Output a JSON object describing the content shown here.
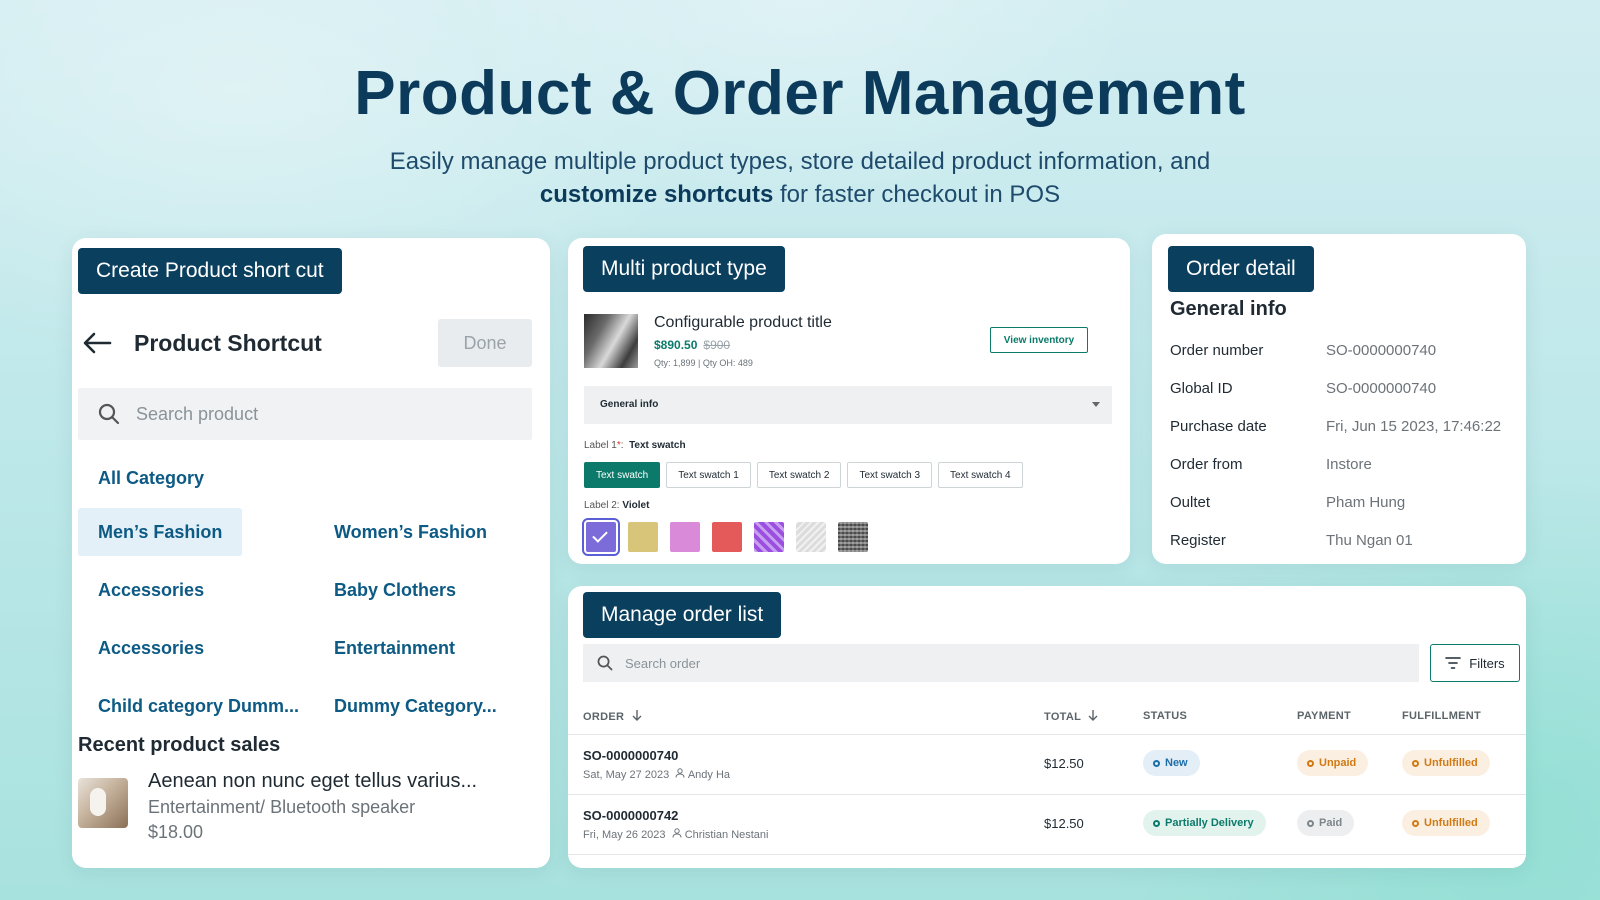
{
  "hero": {
    "title": "Product & Order Management",
    "subtitle_line1": "Easily manage multiple product types, store detailed product information, and",
    "subtitle_bold": "customize shortcuts",
    "subtitle_rest": " for faster checkout in POS"
  },
  "shortcut_card": {
    "tag": "Create Product short cut",
    "title": "Product Shortcut",
    "done_label": "Done",
    "search_placeholder": "Search product",
    "categories": [
      "All Category",
      "Men’s Fashion",
      "Women’s Fashion",
      "Accessories",
      "Baby Clothers",
      "Accessories",
      "Entertainment",
      "Child category Dumm...",
      "Dummy Category..."
    ],
    "recent_title": "Recent product sales",
    "recent_item": {
      "name": "Aenean non nunc eget tellus varius...",
      "category": "Entertainment/ Bluetooth speaker",
      "price": "$18.00"
    }
  },
  "product_card": {
    "tag": "Multi product type",
    "title": "Configurable product title",
    "price": "$890.50",
    "old_price": "$900",
    "qty": "Qty: 1,899 | Qty OH: 489",
    "view_inventory": "View inventory",
    "general_info": "General info",
    "label1_name": "Label 1",
    "label1_req": "*",
    "label1_value": "Text swatch",
    "swatches": [
      "Text swatch",
      "Text swatch 1",
      "Text swatch 2",
      "Text swatch 3",
      "Text swatch 4"
    ],
    "label2_name": "Label 2:",
    "label2_value": "Violet",
    "colors": [
      "#7b6cd9",
      "#d8c57a",
      "#d98ad8",
      "#e45a5a",
      "#9a4fe0",
      "#dcdcdc",
      "#6a6a6a"
    ]
  },
  "order_detail": {
    "tag": "Order detail",
    "section": "General info",
    "rows": [
      {
        "k": "Order number",
        "v": "SO-0000000740"
      },
      {
        "k": "Global ID",
        "v": "SO-0000000740"
      },
      {
        "k": "Purchase date",
        "v": "Fri, Jun 15 2023, 17:46:22"
      },
      {
        "k": "Order from",
        "v": "Instore"
      },
      {
        "k": "Oultet",
        "v": "Pham Hung"
      },
      {
        "k": "Register",
        "v": "Thu Ngan 01"
      }
    ]
  },
  "order_list": {
    "tag": "Manage order list",
    "search_placeholder": "Search order",
    "filters_label": "Filters",
    "headers": {
      "order": "ORDER",
      "total": "TOTAL",
      "status": "STATUS",
      "payment": "PAYMENT",
      "fulfillment": "FULFILLMENT"
    },
    "orders": [
      {
        "id": "SO-0000000740",
        "date": "Sat, May 27 2023",
        "user": "Andy Ha",
        "total": "$12.50",
        "status": "New",
        "payment": "Unpaid",
        "fulfillment": "Unfulfilled"
      },
      {
        "id": "SO-0000000742",
        "date": "Fri, May 26 2023",
        "user": "Christian Nestani",
        "total": "$12.50",
        "status": "Partially Delivery",
        "payment": "Paid",
        "fulfillment": "Unfulfilled"
      }
    ]
  }
}
